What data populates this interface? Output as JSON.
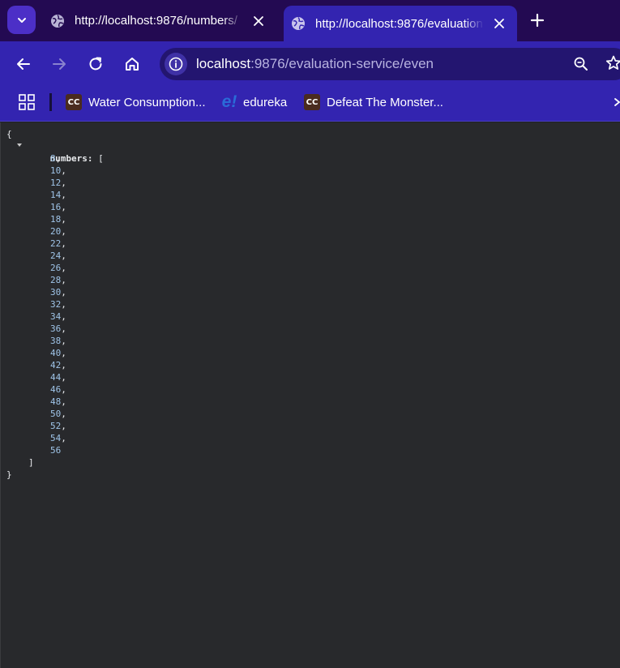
{
  "tabs": [
    {
      "title": "http://localhost:9876/numbers/",
      "active": false
    },
    {
      "title": "http://localhost:9876/evaluation",
      "active": true
    }
  ],
  "address_bar": {
    "host": "localhost",
    "rest": ":9876/evaluation-service/even"
  },
  "bookmarks": [
    {
      "label": "Water Consumption...",
      "icon": "cc-icon"
    },
    {
      "label": "edureka",
      "icon": "edureka-icon"
    },
    {
      "label": "Defeat The Monster...",
      "icon": "cc-icon"
    }
  ],
  "bookmark_badges": {
    "cc": "CC",
    "edureka": "e!"
  },
  "json": {
    "open_brace": "{",
    "key": "numbers:",
    "open_bracket": "[",
    "values": [
      8,
      10,
      12,
      14,
      16,
      18,
      20,
      22,
      24,
      26,
      28,
      30,
      32,
      34,
      36,
      38,
      40,
      42,
      44,
      46,
      48,
      50,
      52,
      54,
      56
    ],
    "close_bracket": "]",
    "close_brace": "}"
  },
  "colors": {
    "tabstrip": "#230a52",
    "toolbar": "#3324b0",
    "omnibox": "#231570",
    "viewer_bg": "#28292c",
    "number_color": "#9fc4e8"
  }
}
